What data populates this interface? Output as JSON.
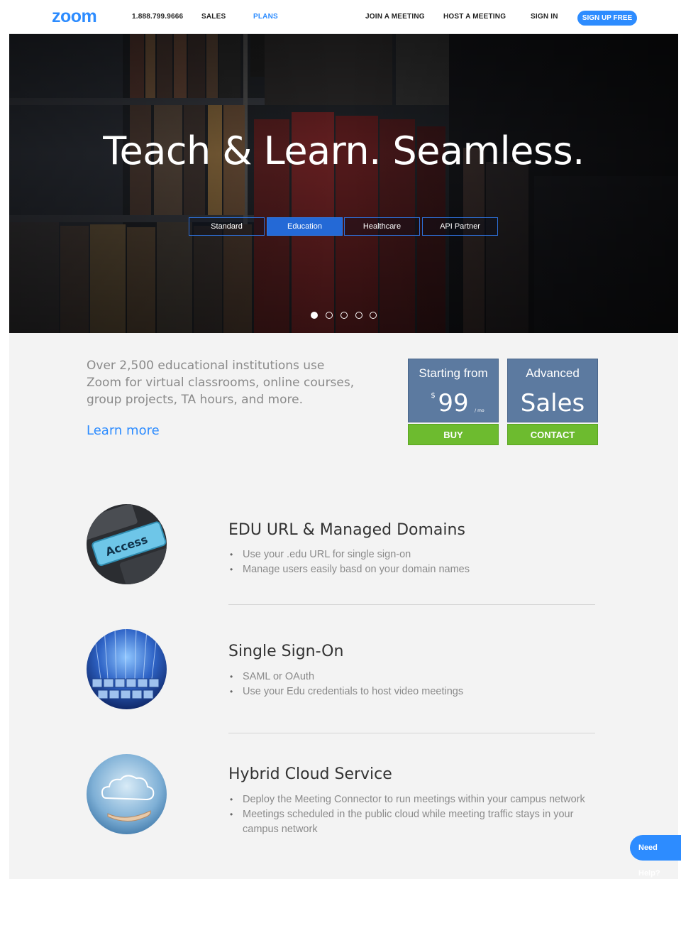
{
  "header": {
    "logo": "zoom",
    "phone": "1.888.799.9666",
    "sales": "SALES",
    "plans": "PLANS",
    "join": "JOIN A MEETING",
    "host": "HOST A MEETING",
    "signin": "SIGN IN",
    "signup": "SIGN UP FREE"
  },
  "hero": {
    "title": "Teach & Learn. Seamless.",
    "tabs": [
      "Standard",
      "Education",
      "Healthcare",
      "API Partner"
    ],
    "active_tab": "Education",
    "slides": 5,
    "active_slide": 1
  },
  "intro": {
    "text": "Over 2,500 educational institutions use Zoom for virtual classrooms, online courses, group projects, TA hours, and more.",
    "learn_more": "Learn more"
  },
  "pricing": {
    "card1_head": "Starting from",
    "card1_currency": "$",
    "card1_amount": "99",
    "card1_per": "/ mo",
    "card1_button": "BUY",
    "card2_head": "Advanced",
    "card2_big": "Sales",
    "card2_button": "CONTACT"
  },
  "features": [
    {
      "title": "EDU URL & Managed Domains",
      "bullets": [
        "Use your .edu URL for single sign-on",
        "Manage users easily basd on your domain names"
      ],
      "image": "keyboard-access-key"
    },
    {
      "title": "Single Sign-On",
      "bullets": [
        "SAML or  OAuth",
        "Use your Edu credentials to host video meetings"
      ],
      "image": "network-cables"
    },
    {
      "title": "Hybrid Cloud Service",
      "bullets": [
        "Deploy the Meeting Connector to run meetings within your campus network",
        "Meetings scheduled in the public cloud while meeting traffic stays in your campus network"
      ],
      "image": "cloud-in-hand"
    }
  ],
  "keyboard_key_text": "Access",
  "help": "Need Help?",
  "colors": {
    "brand_blue": "#2d8cff",
    "green": "#6dbb2f",
    "price_card": "#5c7aa0"
  }
}
